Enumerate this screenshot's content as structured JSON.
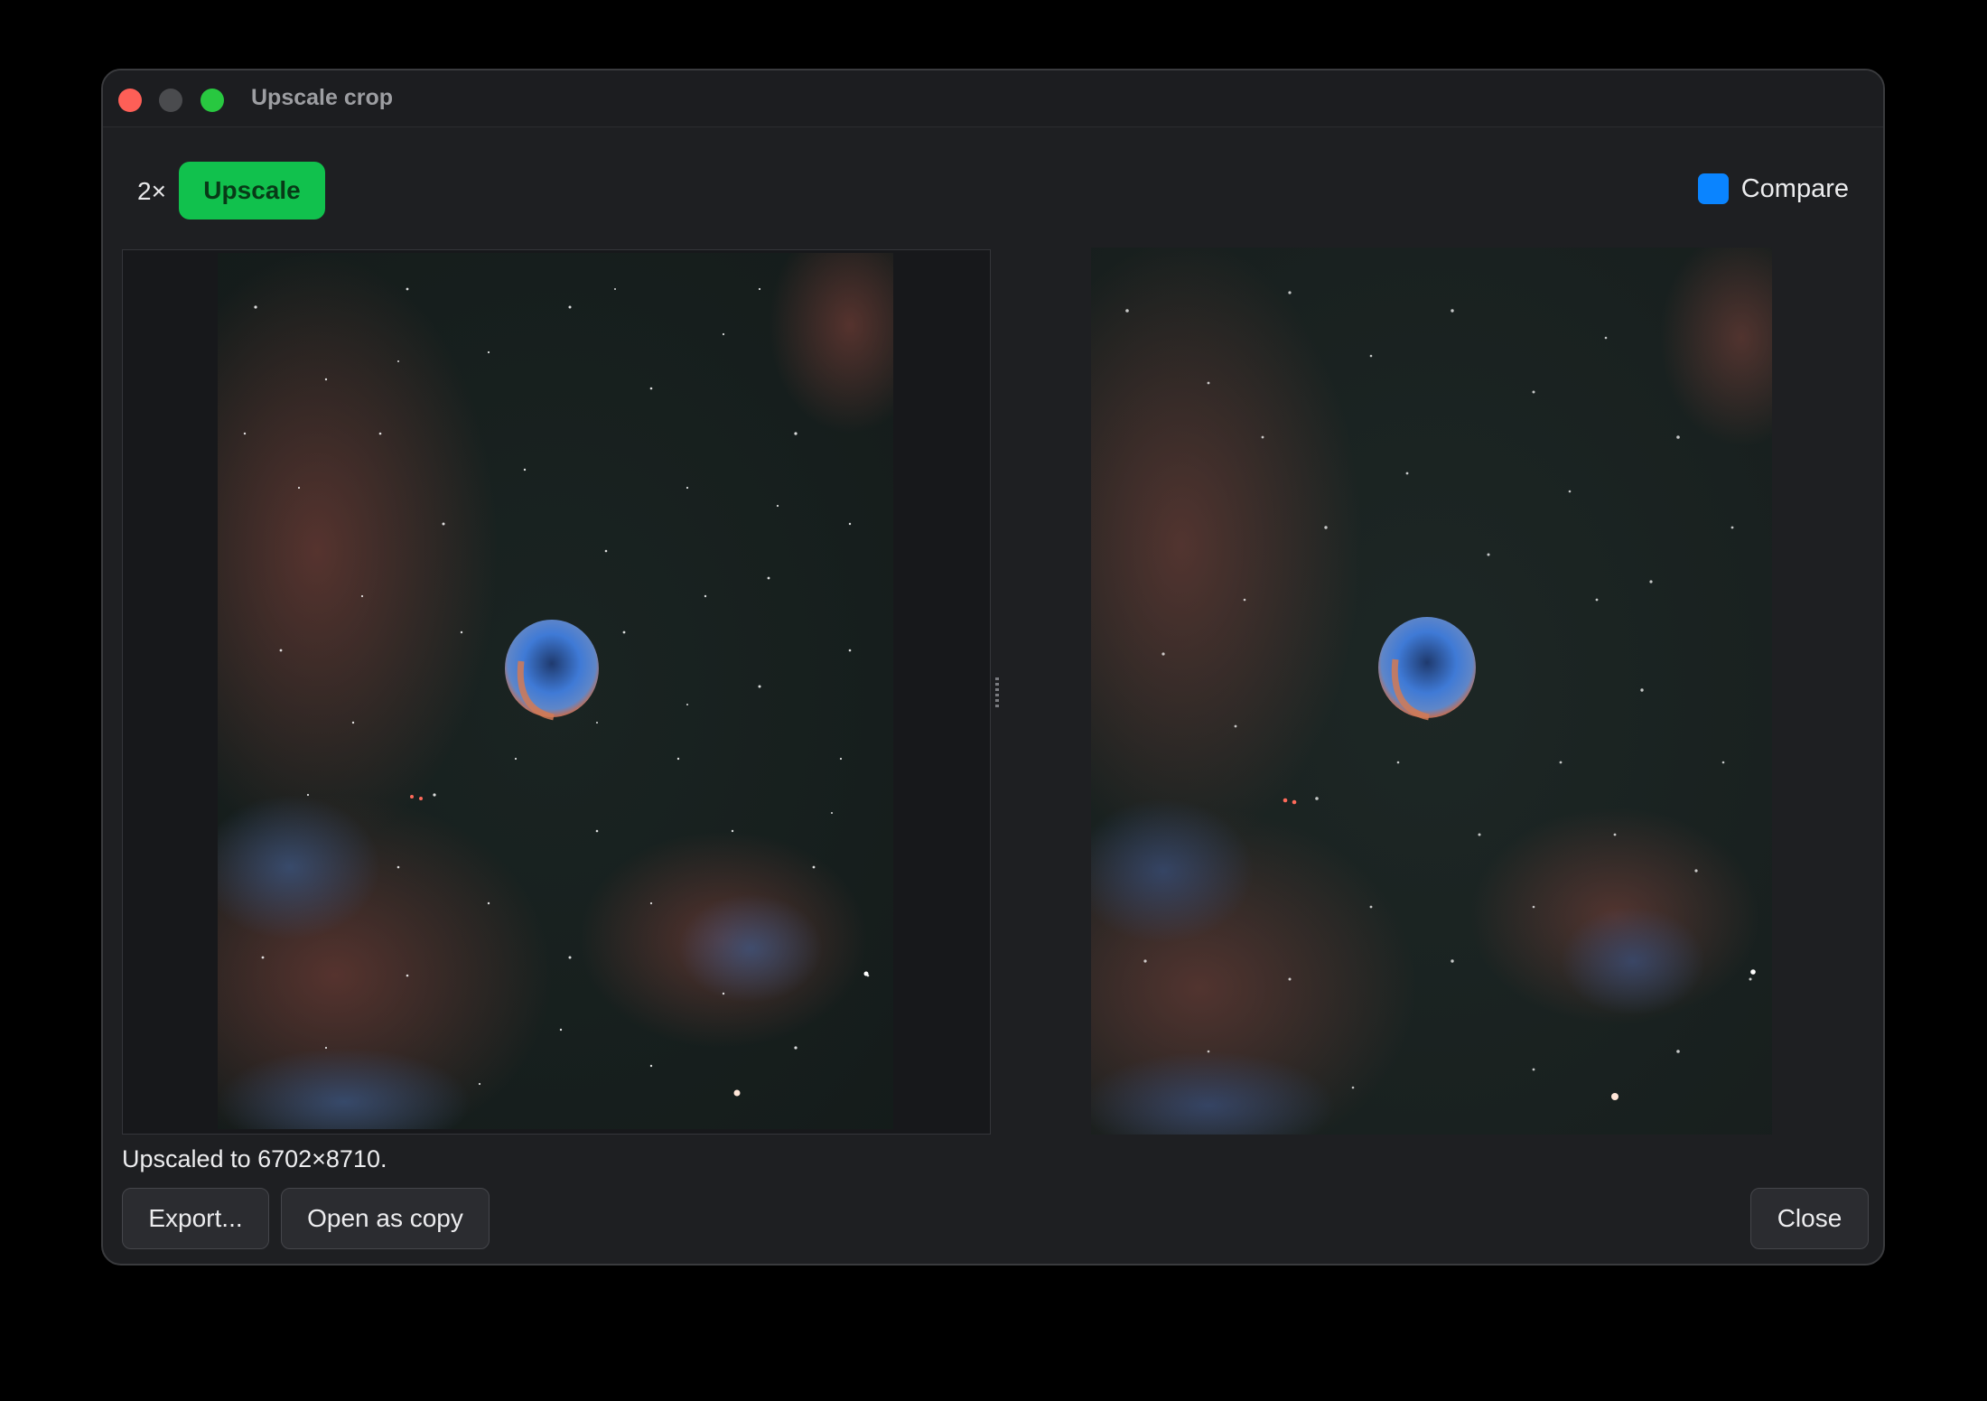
{
  "window": {
    "title": "Upscale crop"
  },
  "toolbar": {
    "scale_factor": "2×",
    "upscale_label": "Upscale",
    "compare_label": "Compare",
    "compare_checked": true
  },
  "images": {
    "left_alt": "Original crop: Crescent Nebula star field",
    "right_alt": "Upscaled result: Crescent Nebula star field"
  },
  "status": {
    "message": "Upscaled to 6702×8710."
  },
  "footer": {
    "export_label": "Export...",
    "open_copy_label": "Open as copy",
    "close_label": "Close"
  },
  "colors": {
    "accent_green": "#11c14d",
    "checkbox_blue": "#0a84ff",
    "window_bg": "#1e1f22"
  }
}
